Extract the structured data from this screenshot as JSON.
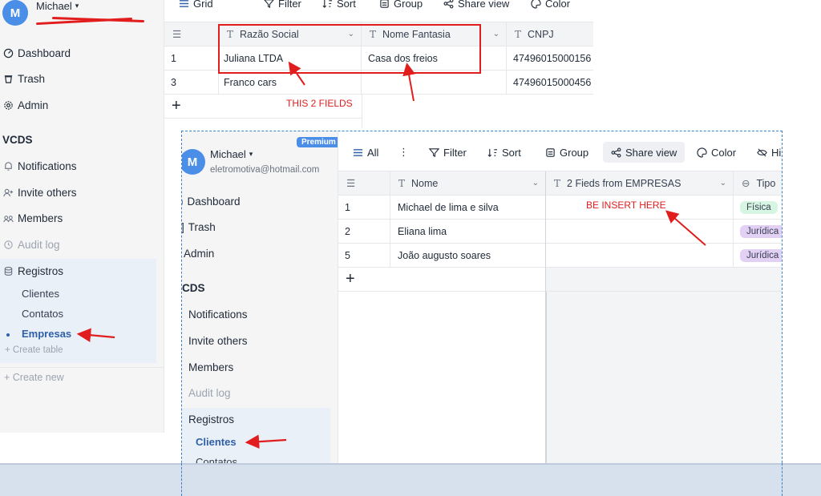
{
  "bg": {
    "user": {
      "initial": "M",
      "name": "Michael"
    },
    "nav": [
      "Dashboard",
      "Trash",
      "Admin"
    ],
    "workspace": "VCDS",
    "ws_nav": [
      "Notifications",
      "Invite others",
      "Members",
      "Audit log",
      "Registros"
    ],
    "tables": [
      "Clientes",
      "Contatos",
      "Empresas"
    ],
    "create_table": "Create table",
    "create_new": "Create new",
    "toolbar": {
      "grid": "Grid",
      "filter": "Filter",
      "sort": "Sort",
      "group": "Group",
      "share": "Share view",
      "color": "Color"
    },
    "columns": [
      "Razão Social",
      "Nome Fantasia",
      "CNPJ"
    ],
    "rows": [
      {
        "num": "1",
        "razao": "Juliana LTDA",
        "fantasia": "Casa dos freios",
        "cnpj": "47496015000156"
      },
      {
        "num": "3",
        "razao": "Franco cars",
        "fantasia": "",
        "cnpj": "47496015000456"
      }
    ],
    "add_row": "+"
  },
  "fg": {
    "premium": "Premium",
    "user": {
      "initial": "M",
      "name": "Michael",
      "email": "eletromotiva@hotmail.com"
    },
    "nav": [
      "Dashboard",
      "Trash",
      "Admin"
    ],
    "workspace": "CDS",
    "ws_nav": [
      "Notifications",
      "Invite others",
      "Members",
      "Audit log",
      "Registros"
    ],
    "tables": [
      "Clientes",
      "Contatos"
    ],
    "toolbar": {
      "all": "All",
      "filter": "Filter",
      "sort": "Sort",
      "group": "Group",
      "share": "Share view",
      "color": "Color",
      "hide": "Hi"
    },
    "columns": [
      "Nome",
      "2 Fieds from EMPRESAS",
      "Tipo"
    ],
    "rows": [
      {
        "num": "1",
        "nome": "Michael de lima e silva",
        "tipo": "Física"
      },
      {
        "num": "2",
        "nome": "Eliana lima",
        "tipo": "Jurídica"
      },
      {
        "num": "5",
        "nome": "João augusto soares",
        "tipo": "Jurídica"
      }
    ],
    "add_row": "+"
  },
  "annotations": {
    "this_2_fields": "THIS 2 FIELDS",
    "be_insert_here": "BE INSERT HERE",
    "color": "#e11d1d"
  },
  "colors": {
    "accent": "#4a8ee8",
    "active_table": "#2f5fa8",
    "fisica_tag": "#d7f5e3",
    "juridica_tag": "#e3d0f5"
  }
}
